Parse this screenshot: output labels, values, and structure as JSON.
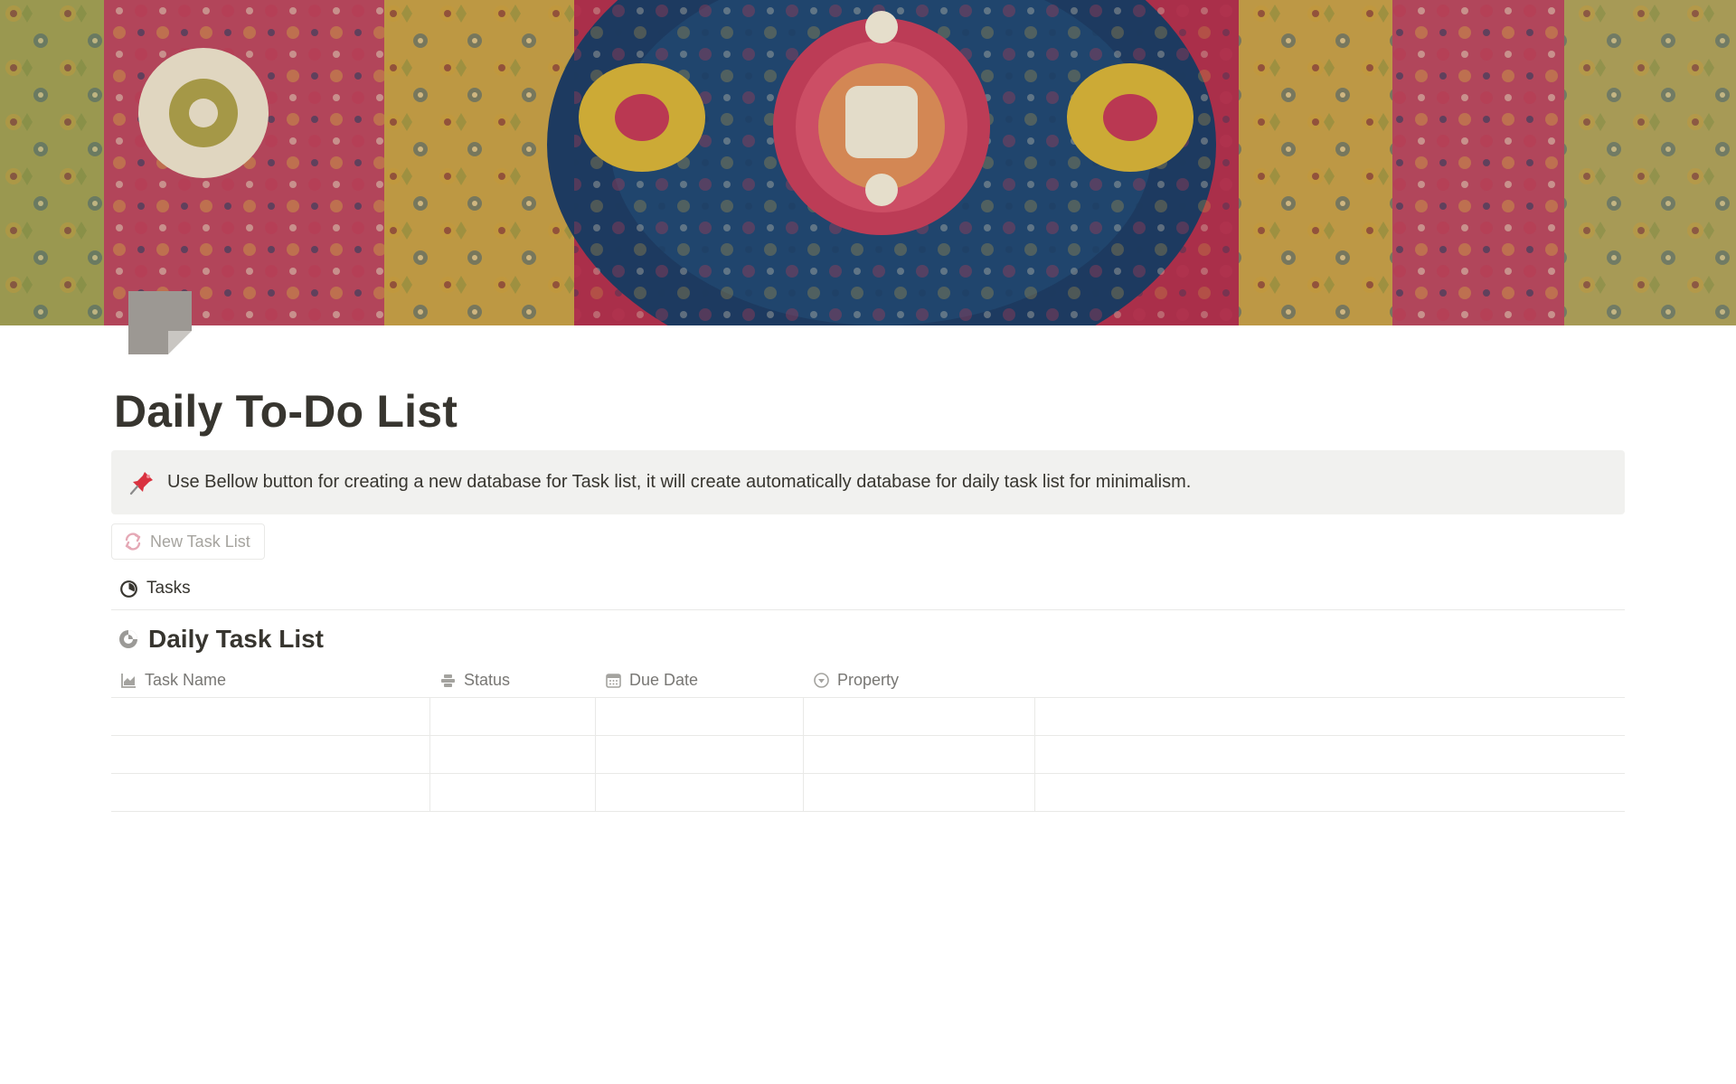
{
  "page": {
    "title": "Daily To-Do List",
    "icon": "sticky-note-icon",
    "cover": "ornate-carpet-pattern-image"
  },
  "callout": {
    "icon": "pushpin-icon",
    "text": "Use Bellow button for creating a new database for Task list,  it will create automatically database for daily task list for minimalism."
  },
  "button": {
    "icon": "refresh-arrows-icon",
    "label": "New Task List"
  },
  "database": {
    "view_tab": {
      "icon": "circle-progress-icon",
      "label": "Tasks"
    },
    "title": "Daily Task List",
    "title_icon": "pie-progress-icon",
    "columns": [
      {
        "label": "Task Name",
        "icon": "chart-area-icon"
      },
      {
        "label": "Status",
        "icon": "stack-icon"
      },
      {
        "label": "Due Date",
        "icon": "calendar-icon"
      },
      {
        "label": "Property",
        "icon": "select-circle-icon"
      }
    ],
    "rows": [
      [
        "",
        "",
        "",
        ""
      ],
      [
        "",
        "",
        "",
        ""
      ],
      [
        "",
        "",
        "",
        ""
      ]
    ]
  },
  "colors": {
    "text": "#37352f",
    "muted": "#787774",
    "callout_bg": "#f1f1ef",
    "border": "#e9e9e7"
  }
}
